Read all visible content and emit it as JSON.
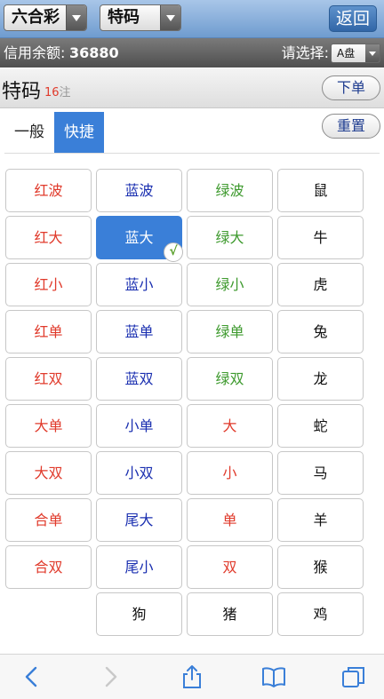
{
  "topbar": {
    "game_select": "六合彩",
    "type_select": "特码",
    "return_label": "返回"
  },
  "creditbar": {
    "credit_label": "信用余额:",
    "credit_value": "36880",
    "choose_label": "请选择:",
    "plate_select": "A盘"
  },
  "title": {
    "text": "特码",
    "count": "16",
    "count_unit": "注",
    "place_order": "下单",
    "reset": "重置"
  },
  "tabs": [
    {
      "label": "一般",
      "active": false
    },
    {
      "label": "快捷",
      "active": true
    }
  ],
  "colors": {
    "red": "#e03a2b",
    "blue": "#1a2fb0",
    "green": "#3e9a2e",
    "black": "#111111",
    "accent": "#3a7fd8"
  },
  "grid": [
    [
      {
        "t": "红波",
        "c": "red"
      },
      {
        "t": "蓝波",
        "c": "blue"
      },
      {
        "t": "绿波",
        "c": "green"
      },
      {
        "t": "鼠",
        "c": "black"
      }
    ],
    [
      {
        "t": "红大",
        "c": "red"
      },
      {
        "t": "蓝大",
        "c": "blue",
        "selected": true
      },
      {
        "t": "绿大",
        "c": "green"
      },
      {
        "t": "牛",
        "c": "black"
      }
    ],
    [
      {
        "t": "红小",
        "c": "red"
      },
      {
        "t": "蓝小",
        "c": "blue"
      },
      {
        "t": "绿小",
        "c": "green"
      },
      {
        "t": "虎",
        "c": "black"
      }
    ],
    [
      {
        "t": "红单",
        "c": "red"
      },
      {
        "t": "蓝单",
        "c": "blue"
      },
      {
        "t": "绿单",
        "c": "green"
      },
      {
        "t": "兔",
        "c": "black"
      }
    ],
    [
      {
        "t": "红双",
        "c": "red"
      },
      {
        "t": "蓝双",
        "c": "blue"
      },
      {
        "t": "绿双",
        "c": "green"
      },
      {
        "t": "龙",
        "c": "black"
      }
    ],
    [
      {
        "t": "大单",
        "c": "red"
      },
      {
        "t": "小单",
        "c": "blue"
      },
      {
        "t": "大",
        "c": "red"
      },
      {
        "t": "蛇",
        "c": "black"
      }
    ],
    [
      {
        "t": "大双",
        "c": "red"
      },
      {
        "t": "小双",
        "c": "blue"
      },
      {
        "t": "小",
        "c": "red"
      },
      {
        "t": "马",
        "c": "black"
      }
    ],
    [
      {
        "t": "合单",
        "c": "red"
      },
      {
        "t": "尾大",
        "c": "blue"
      },
      {
        "t": "单",
        "c": "red"
      },
      {
        "t": "羊",
        "c": "black"
      }
    ],
    [
      {
        "t": "合双",
        "c": "red"
      },
      {
        "t": "尾小",
        "c": "blue"
      },
      {
        "t": "双",
        "c": "red"
      },
      {
        "t": "猴",
        "c": "black"
      }
    ],
    [
      null,
      {
        "t": "狗",
        "c": "black"
      },
      {
        "t": "猪",
        "c": "black"
      },
      {
        "t": "鸡",
        "c": "black"
      }
    ]
  ],
  "toolbar_icons": [
    "back-icon",
    "forward-icon",
    "share-icon",
    "bookmarks-icon",
    "tabs-icon"
  ]
}
